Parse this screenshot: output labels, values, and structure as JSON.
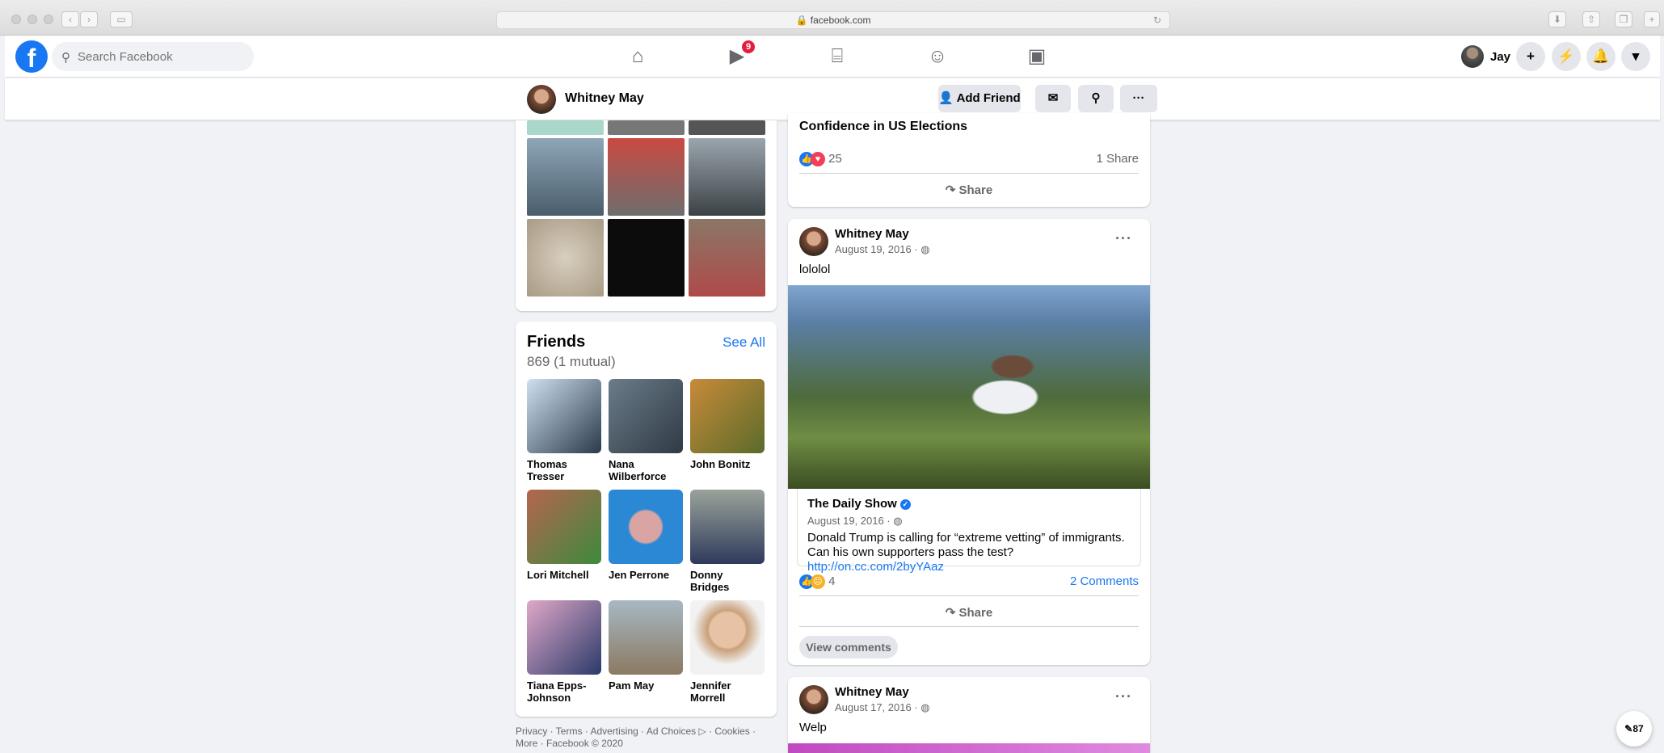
{
  "browser": {
    "url": "facebook.com"
  },
  "nav": {
    "search_placeholder": "Search Facebook",
    "watch_badge": "9",
    "user_name": "Jay"
  },
  "profile": {
    "name": "Whitney May",
    "add_friend": "Add Friend"
  },
  "friends": {
    "title": "Friends",
    "count": "869 (1 mutual)",
    "see_all": "See All",
    "list": [
      {
        "name": "Thomas Tresser"
      },
      {
        "name": "Nana Wilberforce"
      },
      {
        "name": "John Bonitz"
      },
      {
        "name": "Lori Mitchell"
      },
      {
        "name": "Jen Perrone"
      },
      {
        "name": "Donny Bridges"
      },
      {
        "name": "Tiana Epps-Johnson"
      },
      {
        "name": "Pam May"
      },
      {
        "name": "Jennifer Morrell"
      }
    ]
  },
  "footer": {
    "line1": "Privacy · Terms · Advertising · Ad Choices ▷ · Cookies ·",
    "line2": "More · Facebook © 2020"
  },
  "post1": {
    "title": "Confidence in US Elections",
    "reaction_count": "25",
    "shares": "1 Share",
    "share_label": "Share"
  },
  "post2": {
    "author": "Whitney May",
    "date": "August 19, 2016 · ",
    "text": "lololol",
    "link_source": "The Daily Show",
    "link_date": "August 19, 2016 · ",
    "link_text": "Donald Trump is calling for “extreme vetting” of immigrants. Can his own supporters pass the test? ",
    "link_url": "http://on.cc.com/2byYAaz",
    "reaction_count": "4",
    "comments": "2 Comments",
    "share_label": "Share",
    "view_comments": "View comments"
  },
  "post3": {
    "author": "Whitney May",
    "date": "August 17, 2016 · ",
    "text": "Welp"
  },
  "chat": {
    "count": "87"
  },
  "icons": [
    "home-icon",
    "watch-icon",
    "marketplace-icon",
    "groups-icon",
    "gaming-icon",
    "plus-icon",
    "messenger-icon",
    "bell-icon",
    "caret-icon",
    "search-icon",
    "globe-icon",
    "share-icon",
    "like-icon",
    "love-icon",
    "sad-icon"
  ]
}
